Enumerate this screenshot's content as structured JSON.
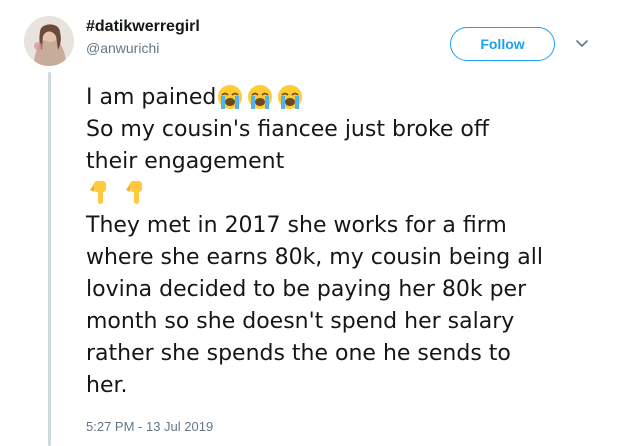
{
  "author": {
    "display_name": "#datikwerregirl",
    "handle": "@anwurichi"
  },
  "actions": {
    "follow_label": "Follow"
  },
  "tweet": {
    "lines": [
      "I am pained",
      "So my cousin's fiancee just broke off",
      "their engagement",
      "",
      "They met in 2017 she works for a firm",
      "where she earns 80k, my cousin being all",
      "lovina decided to be paying her 80k per",
      "month so she doesn't spend her salary",
      "rather she spends the one he sends to",
      "her."
    ],
    "timestamp": "5:27 PM - 13 Jul 2019"
  },
  "icons": {
    "crying_face_emoji": "loudly-crying-face",
    "pointing_down_emoji": "backhand-index-pointing-down",
    "caret": "chevron-down-icon"
  },
  "colors": {
    "accent": "#1da1f2",
    "text": "#14171a",
    "secondary_text": "#657786",
    "thread_line": "#cfd9de"
  }
}
